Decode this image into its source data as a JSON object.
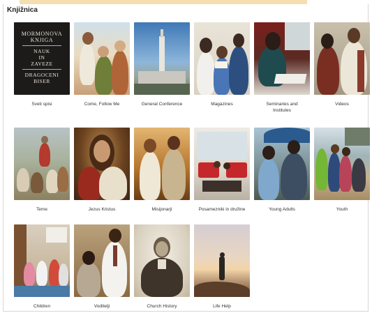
{
  "page": {
    "title": "Knjižnica"
  },
  "book_cover": {
    "line1": "MORMONOVA",
    "line2": "KNJIGA",
    "line3": "NAUK",
    "line4": "IN",
    "line5": "ZAVEZE",
    "line6": "DRAGOCENI",
    "line7": "BISER"
  },
  "tiles": [
    {
      "label": "Sveti spisi"
    },
    {
      "label": "Come, Follow Me"
    },
    {
      "label": "General Conference"
    },
    {
      "label": "Magazines"
    },
    {
      "label": "Seminaries and Institutes"
    },
    {
      "label": "Videos"
    },
    {
      "label": "Teme"
    },
    {
      "label": "Jezus Kristus"
    },
    {
      "label": "Misijonarji"
    },
    {
      "label": "Posamezniki in družine"
    },
    {
      "label": "Young Adults"
    },
    {
      "label": "Youth"
    },
    {
      "label": "Children"
    },
    {
      "label": "Voditelji"
    },
    {
      "label": "Church History"
    },
    {
      "label": "Life Help"
    }
  ]
}
